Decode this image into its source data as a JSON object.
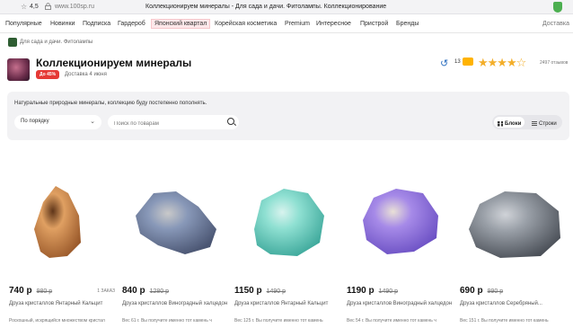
{
  "browser": {
    "rating": "4,5",
    "url": "www.100sp.ru",
    "tab_title": "Коллекционируем минералы - Для сада и дачи. Фитолампы. Коллекционирование"
  },
  "nav": {
    "items": [
      "Популярные",
      "Новинки",
      "Подписка",
      "Гардероб",
      "Японский квартал",
      "Корейская косметика",
      "Premium",
      "Интересное",
      "Пристрой",
      "Бренды"
    ],
    "active_index": 4,
    "right": "Доставка"
  },
  "breadcrumb": "Для сада и дачи. Фитолампы",
  "header": {
    "title": "Коллекционируем минералы",
    "badge": "До 45%",
    "delivery": "Доставка 4 июня",
    "reviews_count": "13",
    "stars_value": 4.5,
    "ratings_text": "2497 отзывов"
  },
  "panel": {
    "description": "Натуральные природные минералы, коллекцию буду постепенно пополнять.",
    "sort_label": "По порядку",
    "search_placeholder": "Поиск по товарам",
    "view_blocks": "Блоки",
    "view_rows": "Строки"
  },
  "products": [
    {
      "price": "740 р",
      "old_price": "980 р",
      "orders": "1 ЗАКАЗ",
      "name": "Друза кристаллов Янтарный Кальцит",
      "subtext": "Роскошный, искрящийся множеством кристал",
      "colors": [
        "#e0a062",
        "#9b5a2b",
        "#5e3519"
      ]
    },
    {
      "price": "840 р",
      "old_price": "1280 р",
      "orders": "",
      "name": "Друза кристаллов Виноградный халцедон",
      "subtext": "Вес 61 г. Вы получите именно тот камень ч",
      "colors": [
        "#8898b8",
        "#4a5572",
        "#c9c9c9"
      ]
    },
    {
      "price": "1150 р",
      "old_price": "1490 р",
      "orders": "",
      "name": "Друза кристаллов Янтарный Кальцит",
      "subtext": "Вес 125 г. Вы получите именно тот камень",
      "colors": [
        "#8fe0d2",
        "#3ca79a",
        "#d8f3ee"
      ]
    },
    {
      "price": "1190 р",
      "old_price": "1490 р",
      "orders": "",
      "name": "Друза кристаллов Виноградный халцедон",
      "subtext": "Вес 54 г. Вы получите именно тот камень ч",
      "colors": [
        "#a68ae8",
        "#6a4fc3",
        "#e9e0d6"
      ]
    },
    {
      "price": "690 р",
      "old_price": "990 р",
      "orders": "",
      "name": "Друза кристаллов Серебряный...",
      "subtext": "Вес 151 г. Вы получите именно тот камень",
      "colors": [
        "#9aa0a8",
        "#4b5058",
        "#d0d3d8"
      ]
    }
  ]
}
